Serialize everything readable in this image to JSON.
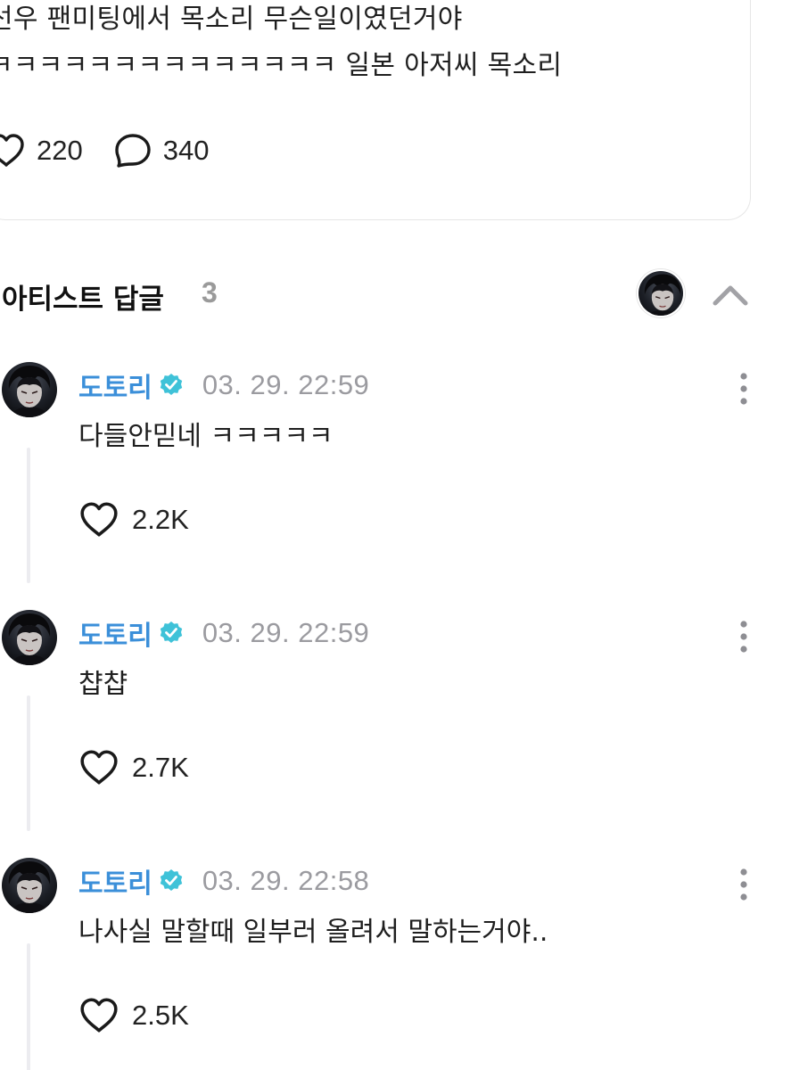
{
  "post": {
    "text_lines": [
      "선우 팬미팅에서 목소리 무슨일이였던거야",
      "ㅋㅋㅋㅋㅋㅋㅋㅋㅋㅋㅋㅋㅋㅋ 일본 아저씨 목소리"
    ],
    "likes": "220",
    "comments": "340"
  },
  "artist_replies": {
    "title": "아티스트 답글",
    "count": "3"
  },
  "replies": [
    {
      "author": "도토리",
      "verified": true,
      "time": "03. 29. 22:59",
      "text": "다들안믿네 ㅋㅋㅋㅋㅋ",
      "likes": "2.2K"
    },
    {
      "author": "도토리",
      "verified": true,
      "time": "03. 29. 22:59",
      "text": "챱챱",
      "likes": "2.7K"
    },
    {
      "author": "도토리",
      "verified": true,
      "time": "03. 29. 22:58",
      "text": "나사실 말할때 일부러 올려서 말하는거야..",
      "likes": "2.5K"
    }
  ],
  "colors": {
    "author": "#3b8fd9",
    "verified_badge": "#3fc2d8",
    "timestamp": "#9b9ba0",
    "count": "#9a9a9a"
  },
  "icons": {
    "like": "heart-outline-icon",
    "comment": "speech-bubble-outline-icon",
    "verified": "verified-badge-icon",
    "more": "vertical-ellipsis-icon",
    "collapse": "chevron-up-icon"
  }
}
